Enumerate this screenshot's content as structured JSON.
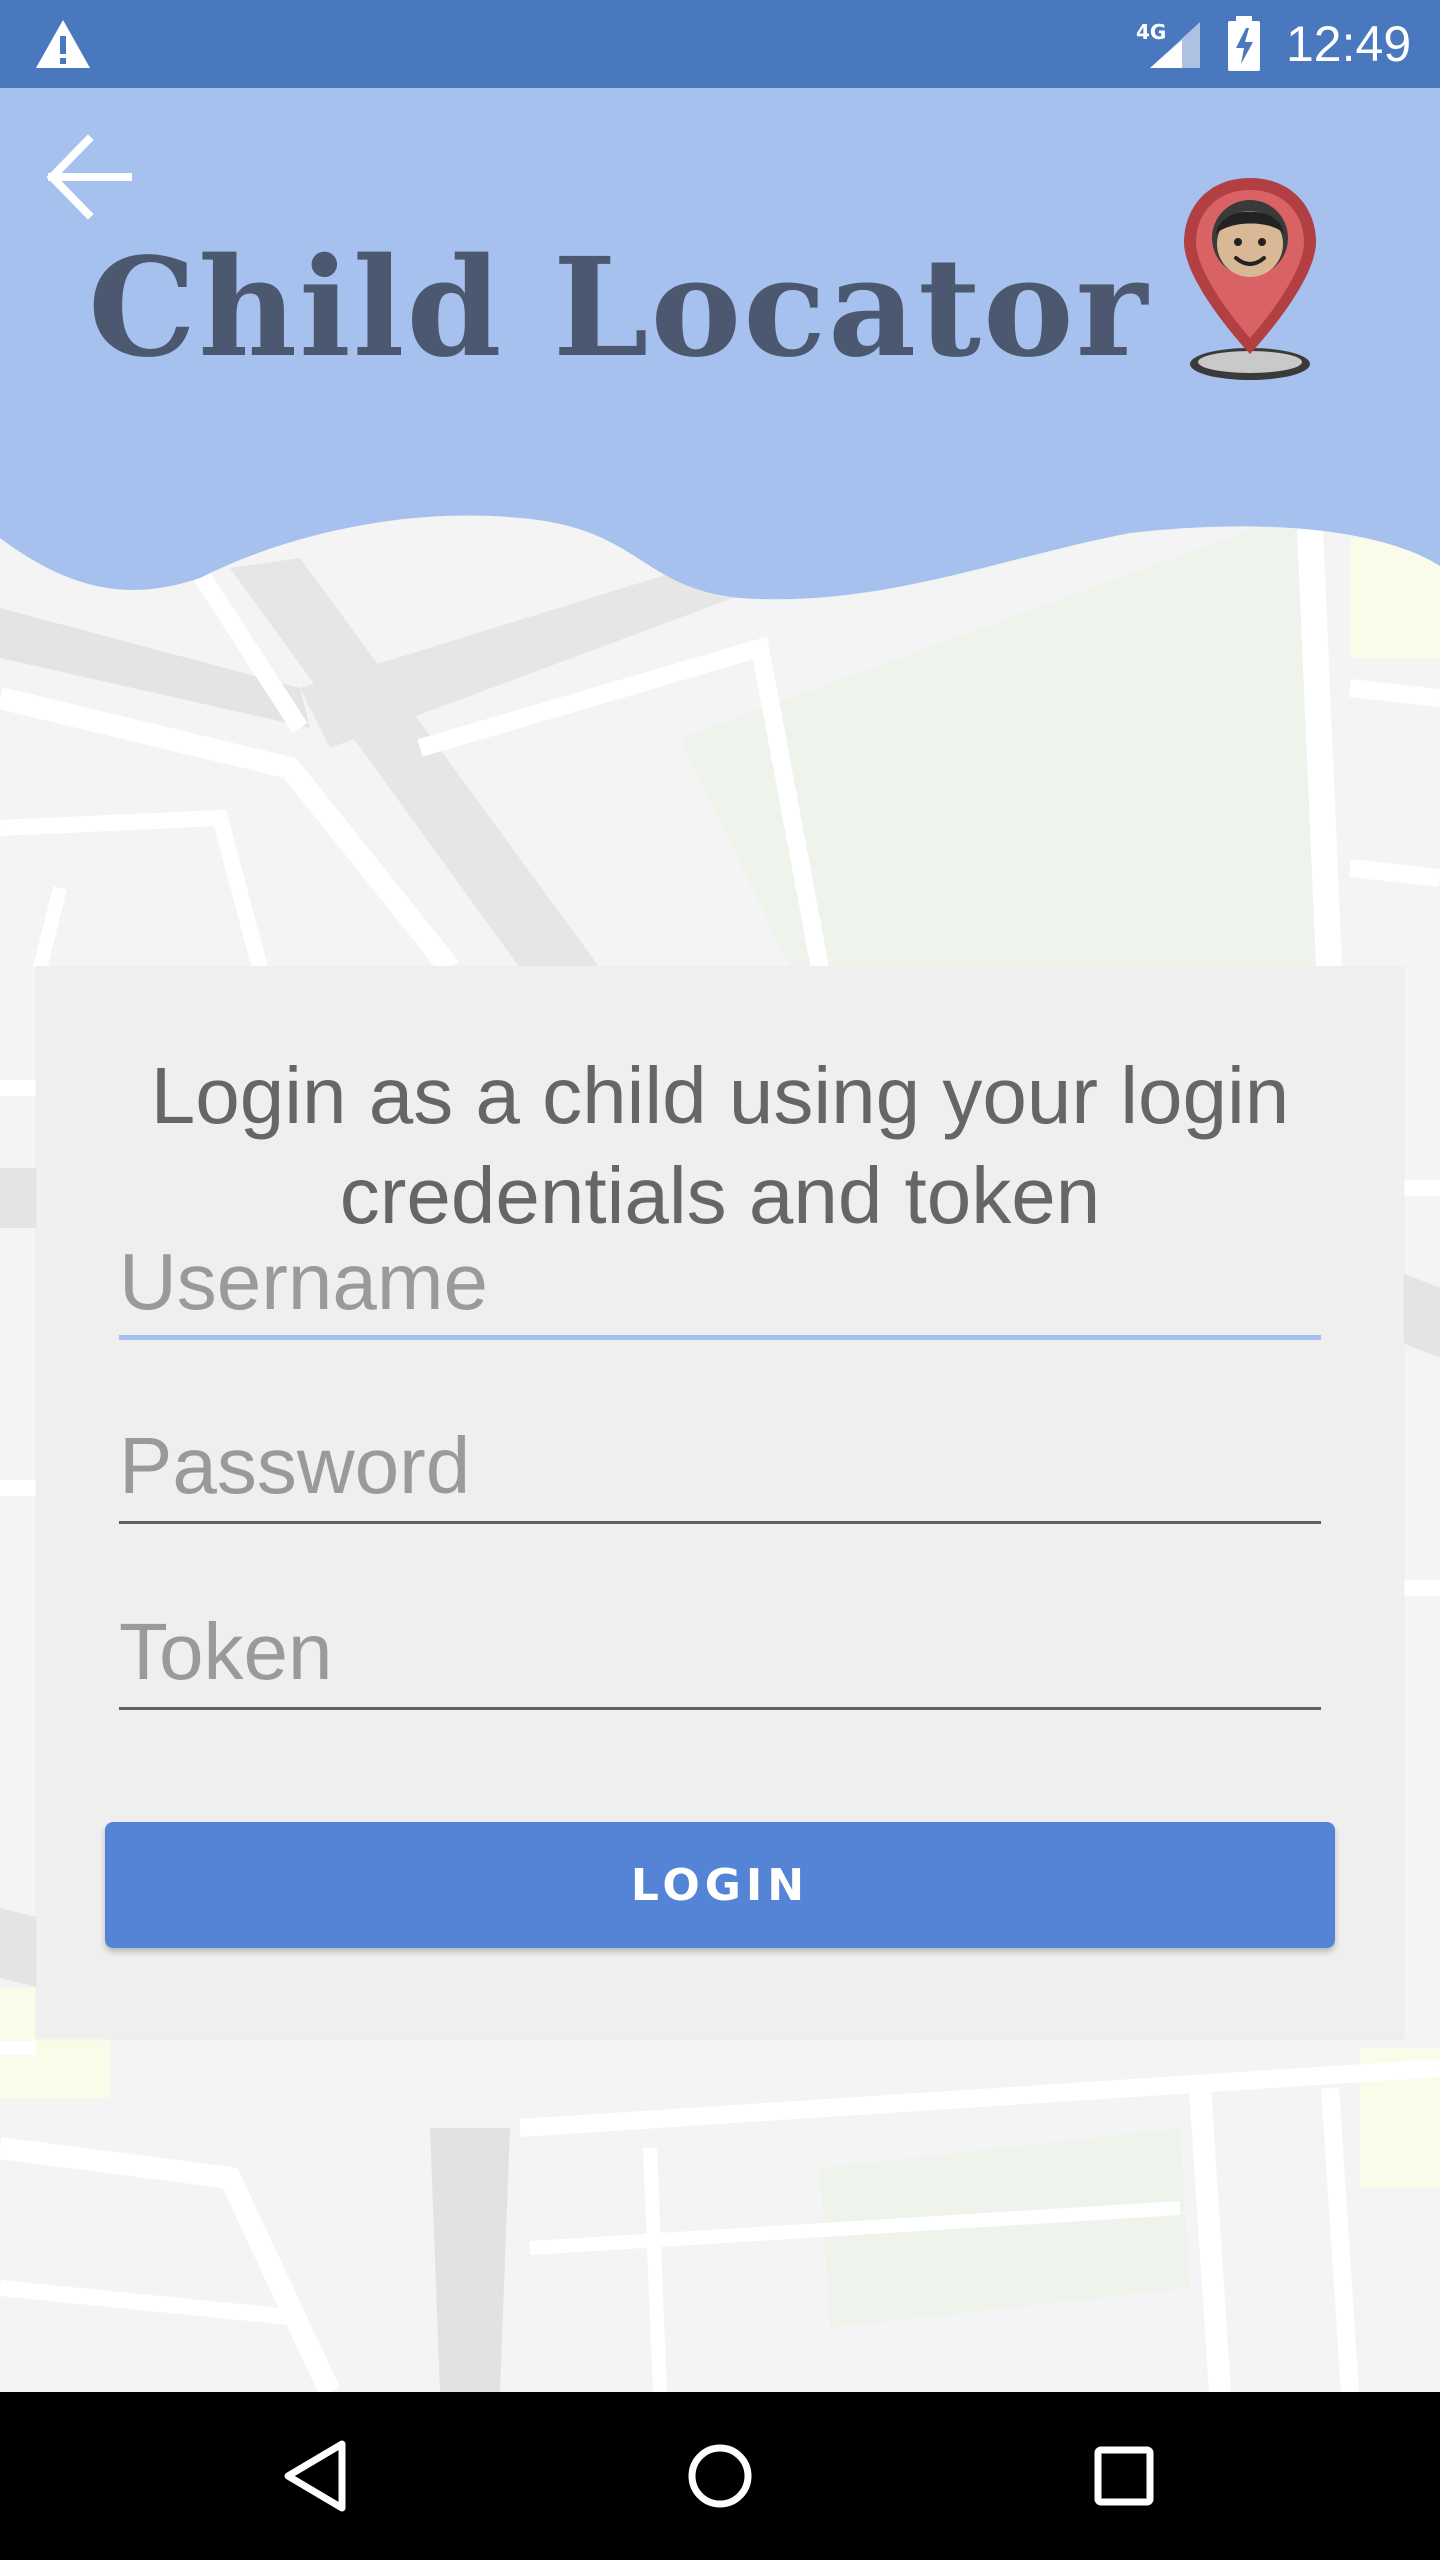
{
  "status_bar": {
    "network": "4G",
    "time": "12:49",
    "icons": [
      "alert-icon",
      "signal-icon",
      "battery-charging-icon"
    ]
  },
  "header": {
    "title": "Child Locator",
    "back_icon": "arrow-left-icon",
    "logo_icon": "child-location-pin-icon",
    "colors": {
      "wave": "#a7c1ef",
      "title": "#4b5870",
      "status_bar": "#4a78bf"
    }
  },
  "login_card": {
    "message": "Login as a child using your login credentials and token",
    "fields": {
      "username": {
        "placeholder": "Username",
        "value": ""
      },
      "password": {
        "placeholder": "Password",
        "value": ""
      },
      "token": {
        "placeholder": "Token",
        "value": ""
      }
    },
    "login_label": "LOGIN",
    "colors": {
      "button": "#5584d6",
      "active_underline": "#a7c1ef"
    }
  },
  "nav_bar": {
    "icons": [
      "triangle-back-icon",
      "circle-home-icon",
      "square-recent-icon"
    ]
  }
}
